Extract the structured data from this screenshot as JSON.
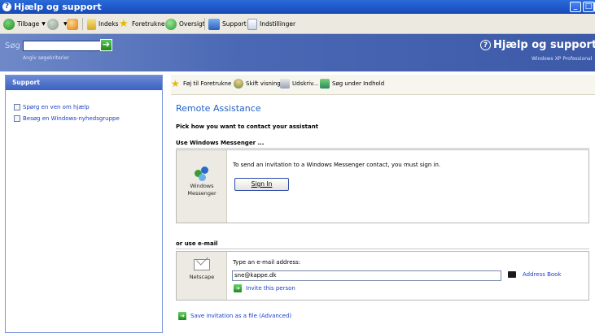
{
  "window": {
    "title": "Hjælp og support",
    "title_icon": "help-icon"
  },
  "toolbar": {
    "back_label": "Tilbage",
    "index_label": "Indeks",
    "favorites_label": "Foretrukne",
    "history_label": "Oversigt",
    "support_label": "Support",
    "options_label": "Indstillinger"
  },
  "search": {
    "label": "Søg",
    "value": "",
    "criteria_label": "Angiv søgekriterier"
  },
  "brand": {
    "title": "Hjælp og support",
    "subtitle": "Windows XP Professional"
  },
  "sidebar": {
    "header": "Support",
    "items": [
      {
        "label": "Spørg en ven om hjælp"
      },
      {
        "label": "Besøg en Windows-nyhedsgruppe"
      }
    ]
  },
  "actions": {
    "add_favorites": "Føj til Foretrukne",
    "change_view": "Skift visning",
    "print": "Udskriv...",
    "search_in_index": "Søg under Indhold"
  },
  "main": {
    "title": "Remote Assistance",
    "prompt": "Pick how you want to contact your assistant",
    "messenger_section": "Use Windows Messenger ...",
    "messenger_label_line1": "Windows",
    "messenger_label_line2": "Messenger",
    "messenger_text": "To send an invitation to a Windows Messenger contact, you must sign in.",
    "sign_in_label": "Sign In",
    "email_section": "or use e-mail",
    "email_client_label": "Netscape",
    "email_prompt": "Type an e-mail address:",
    "email_value": "sne@kappe.dk",
    "address_book_label": "Address Book",
    "invite_label": "Invite this person",
    "save_invitation_label": "Save invitation as a file (Advanced)"
  },
  "colors": {
    "titlebar": "#1e57c9",
    "heading": "#2460c8",
    "link": "#1a3ec8"
  }
}
